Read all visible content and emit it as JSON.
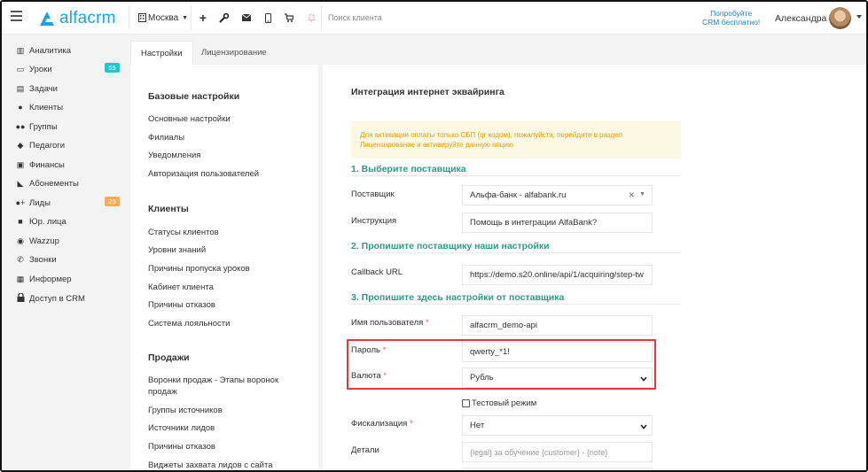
{
  "header": {
    "logo_text": "alfacrm",
    "city": "Москва",
    "search_placeholder": "Поиск клиента",
    "try_line1": "Попробуйте",
    "try_line2": "CRM бесплатно!",
    "user_name": "Александра",
    "icons": [
      "menu-icon",
      "building-icon",
      "plus-icon",
      "wrench-icon",
      "mail-icon",
      "phone-icon",
      "cart-icon",
      "bell-icon"
    ]
  },
  "sidebar": {
    "items": [
      {
        "label": "Аналитика",
        "icon": "chart-icon"
      },
      {
        "label": "Уроки",
        "icon": "calendar-icon",
        "badge": "55",
        "badge_color": "#23c6c8"
      },
      {
        "label": "Задачи",
        "icon": "tasks-icon"
      },
      {
        "label": "Клиенты",
        "icon": "user-icon"
      },
      {
        "label": "Группы",
        "icon": "users-icon"
      },
      {
        "label": "Педагоги",
        "icon": "graduation-icon"
      },
      {
        "label": "Финансы",
        "icon": "money-icon"
      },
      {
        "label": "Абонементы",
        "icon": "tag-icon"
      },
      {
        "label": "Лиды",
        "icon": "user-plus-icon",
        "badge": "25",
        "badge_color": "#f8ac59"
      },
      {
        "label": "Юр. лица",
        "icon": "briefcase-icon"
      },
      {
        "label": "Wazzup",
        "icon": "whatsapp-icon"
      },
      {
        "label": "Звонки",
        "icon": "phone-call-icon"
      },
      {
        "label": "Информер",
        "icon": "newspaper-icon"
      },
      {
        "label": "Доступ в CRM",
        "icon": "lock-icon"
      }
    ]
  },
  "tabs": [
    {
      "label": "Настройки",
      "active": true
    },
    {
      "label": "Лицензирование",
      "active": false
    }
  ],
  "settings_menu": {
    "basic_title": "Базовые настройки",
    "basic_items": [
      "Основные настройки",
      "Филиалы",
      "Уведомления",
      "Авторизация пользователей"
    ],
    "clients_title": "Клиенты",
    "clients_items": [
      "Статусы клиентов",
      "Уровни знаний",
      "Причины пропуска уроков",
      "Кабинет клиента",
      "Причины отказов",
      "Система лояльности"
    ],
    "sales_title": "Продажи",
    "sales_items": [
      "Воронки продаж - Этапы воронок продаж",
      "Группы источников",
      "Источники лидов",
      "Причины отказов",
      "Виджеты захвата лидов с сайта"
    ]
  },
  "main": {
    "title": "Интеграция интернет эквайринга",
    "alert": "Для активации оплаты только СБП (qr кодом), пожалуйста, перейдите в раздел Лицензирование и активируйте данную опцию",
    "step1": "1. Выберите поставщика",
    "step2": "2. Пропишите поставщику наши настройки",
    "step3": "3. Пропишите здесь настройки от поставщика",
    "provider_label": "Поставщик",
    "provider_value": "Альфа-банк - alfabank.ru",
    "instruction_label": "Инструкция",
    "instruction_value": "Помощь в интеграции AlfaBank?",
    "callback_label": "Callback URL",
    "callback_value": "https://demo.s20.online/api/1/acquiring/step-tw",
    "username_label": "Имя пользователя",
    "username_value": "alfacrm_demo-api",
    "password_label": "Пароль",
    "password_value": "qwerty_*1!",
    "currency_label": "Валюта",
    "currency_value": "Рубль",
    "test_mode_label": "Тестовый режим",
    "fiscal_label": "Фискализация",
    "fiscal_value": "Нет",
    "details_label": "Детали",
    "details_placeholder": "{legal} за обучение {customer} - {note}",
    "required_mark": "*"
  },
  "colors": {
    "accent": "#1aa5dc",
    "step_green": "#2d9c84",
    "alert_bg": "#fcf8e3",
    "alert_text": "#e99a05",
    "highlight_red": "#e03a3a"
  }
}
